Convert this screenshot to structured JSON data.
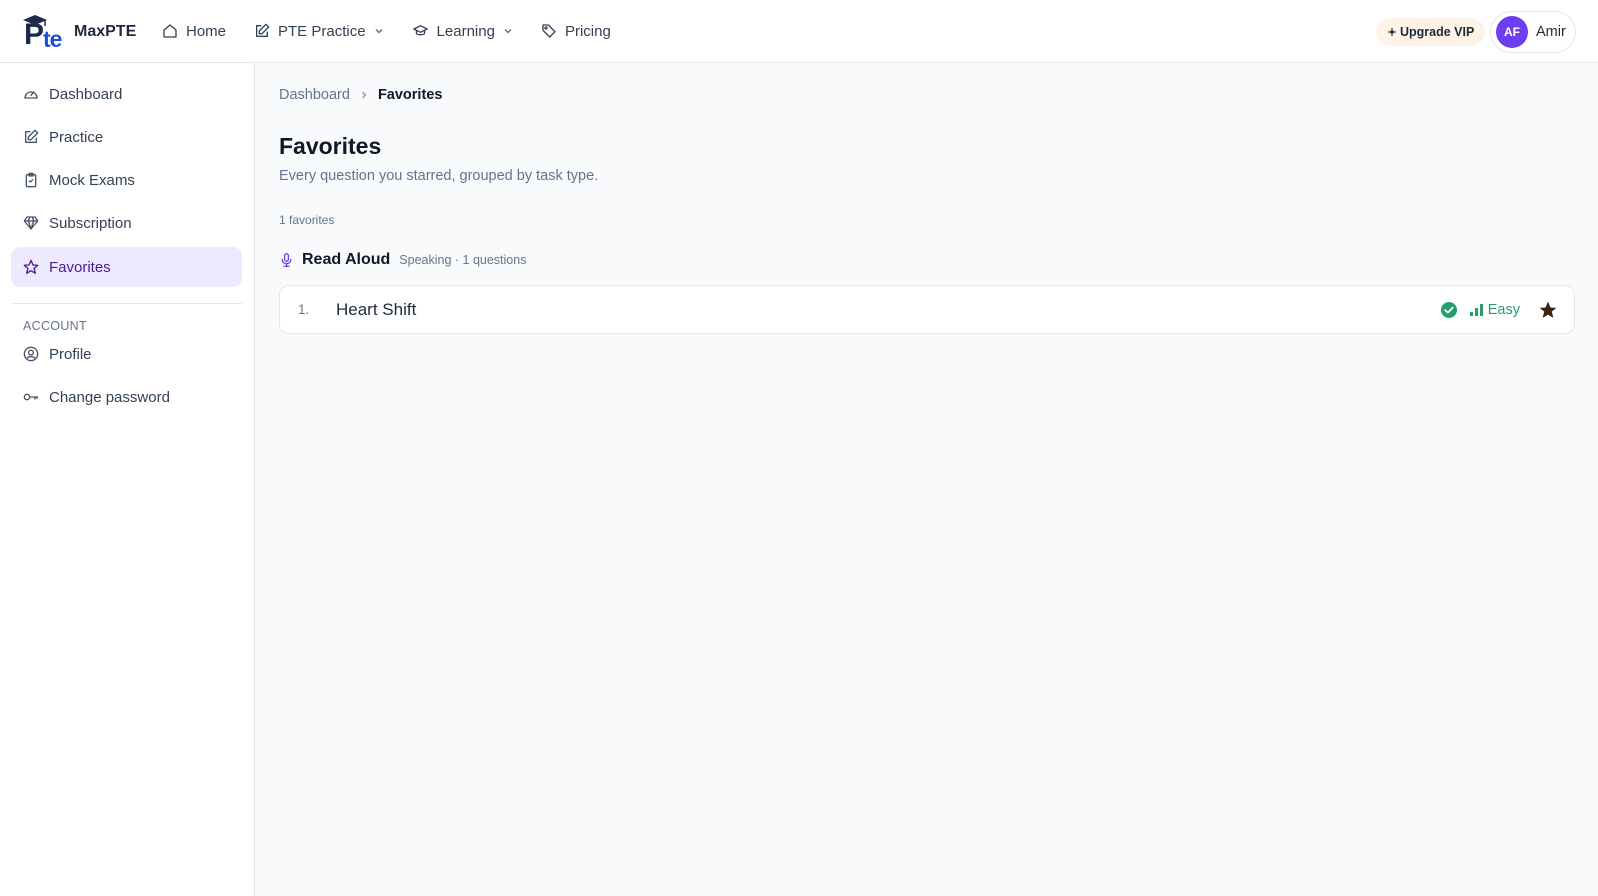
{
  "brand": {
    "logo_text": "Pte",
    "name": "MaxPTE"
  },
  "nav": {
    "items": [
      {
        "label": "Home",
        "icon": "home-icon"
      },
      {
        "label": "PTE Practice",
        "icon": "edit-icon",
        "dropdown": true
      },
      {
        "label": "Learning",
        "icon": "graduation-cap-icon",
        "dropdown": true
      },
      {
        "label": "Pricing",
        "icon": "tag-icon"
      }
    ]
  },
  "header": {
    "upgrade_label": "Upgrade VIP",
    "user": {
      "initials": "AF",
      "name": "Amir",
      "avatar_color": "#6d3ef0"
    }
  },
  "sidebar": {
    "items": [
      {
        "label": "Dashboard",
        "icon": "gauge-icon"
      },
      {
        "label": "Practice",
        "icon": "edit-icon"
      },
      {
        "label": "Mock Exams",
        "icon": "clipboard-check-icon"
      },
      {
        "label": "Subscription",
        "icon": "diamond-icon"
      },
      {
        "label": "Favorites",
        "icon": "star-icon",
        "active": true
      }
    ],
    "account_section": "ACCOUNT",
    "account_items": [
      {
        "label": "Profile",
        "icon": "user-circle-icon"
      },
      {
        "label": "Change password",
        "icon": "key-icon"
      }
    ]
  },
  "breadcrumb": {
    "parent": "Dashboard",
    "current": "Favorites"
  },
  "page": {
    "title": "Favorites",
    "subtitle": "Every question you starred, grouped by task type.",
    "count": "1 favorites"
  },
  "groups": [
    {
      "title": "Read Aloud",
      "meta": "Speaking · 1 questions",
      "icon": "microphone-icon",
      "items": [
        {
          "index": "1.",
          "title": "Heart Shift",
          "status": "completed",
          "difficulty": "Easy",
          "starred": true
        }
      ]
    }
  ],
  "colors": {
    "accent": "#6d3ef0",
    "active_bg": "#ede9fe",
    "easy": "#22a06b",
    "completed": "#22a06b",
    "upgrade_bg": "#fdf3e6"
  }
}
